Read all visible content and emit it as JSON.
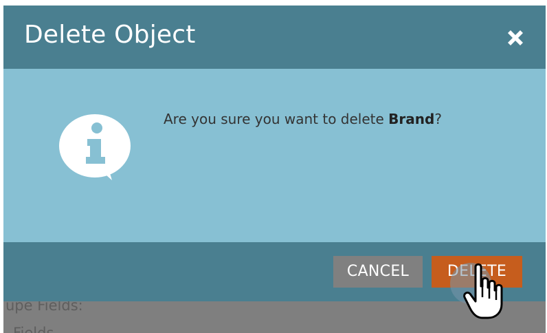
{
  "dialog": {
    "title": "Delete Object",
    "close_icon": "close-icon",
    "info_icon": "info-speech-bubble-icon",
    "message": {
      "prefix": "Are you sure you want to delete ",
      "object_name": "Brand",
      "suffix": "?"
    },
    "buttons": {
      "cancel_label": "CANCEL",
      "delete_label": "DELETE"
    }
  },
  "background": {
    "partial_text_1": "upe Fields:",
    "partial_text_2": "Fields"
  },
  "cursor": {
    "icon": "hand-pointer-cursor-icon"
  },
  "colors": {
    "header": "#4a7f90",
    "body": "#87c0d3",
    "cancel": "#808080",
    "delete": "#c65d1d",
    "overlay": "#7f7f7f"
  }
}
